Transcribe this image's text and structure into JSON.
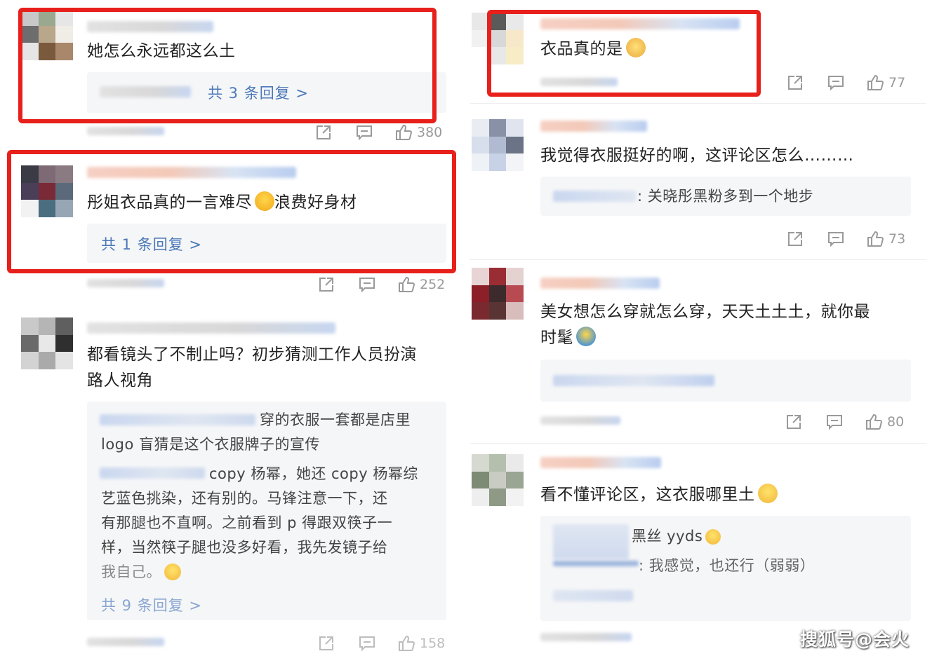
{
  "comments_left": [
    {
      "text": "她怎么永远都这么土",
      "reply_link": "共 3 条回复 >",
      "likes": "380"
    },
    {
      "text": "彤姐衣品真的一言难尽",
      "text_after_emoji": "浪费好身材",
      "reply_link": "共 1 条回复 >",
      "likes": "252"
    },
    {
      "text_line1": "都看镜头了不制止吗？初步猜测工作人员扮演",
      "text_line2": "路人视角",
      "reply1_line1": "穿的衣服一套都是店里",
      "reply1_line2": "logo 盲猜是这个衣服牌子的宣传",
      "reply2_line1": "copy 杨幂，她还 copy 杨幂综",
      "reply2_line2": "艺蓝色挑染，还有别的。马锋注意一下，还",
      "reply2_line3": "有那腿也不直啊。之前看到 p 得跟双筷子一",
      "reply2_line4": "样，当然筷子腿也没多好看，我先发镜子给",
      "reply2_line5": "我自己。",
      "reply_link": "共 9 条回复 >",
      "likes": "158"
    }
  ],
  "comments_right": [
    {
      "text": "衣品真的是",
      "likes": "77"
    },
    {
      "text": "我觉得衣服挺好的啊，这评论区怎么………",
      "reply1": ": 关晓彤黑粉多到一个地步",
      "likes": "73"
    },
    {
      "text_line1": "美女想怎么穿就怎么穿，天天土土土，就你最",
      "text_line2": "时髦",
      "likes": "80"
    },
    {
      "text": "看不懂评论区，这衣服哪里土",
      "reply1": "黑丝 yyds",
      "reply2": ": 我感觉，也还行（弱弱）"
    }
  ],
  "watermark": "搜狐号@会火",
  "colors": {
    "highlight": "#e8201c",
    "link": "#4a78b8",
    "count": "#9a9a9a"
  },
  "icons": [
    "share-icon",
    "comment-icon",
    "like-icon"
  ]
}
